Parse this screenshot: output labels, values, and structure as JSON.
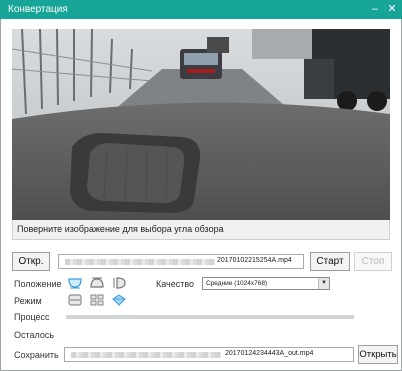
{
  "window": {
    "title": "Конвертация",
    "minimize_glyph": "–",
    "close_glyph": "✕"
  },
  "video": {
    "hint": "Поверните изображение для выбора угла обзора"
  },
  "input": {
    "open_label": "Откр.",
    "filename": "20170102215254A.mp4",
    "start_label": "Старт",
    "stop_label": "Стоп"
  },
  "position": {
    "label": "Положение",
    "icons": [
      "dome-front-icon",
      "dome-back-icon",
      "dome-side-icon"
    ]
  },
  "quality": {
    "label": "Качество",
    "selected": "Средние (1024x768)"
  },
  "mode": {
    "label": "Режим",
    "icons": [
      "panorama-strip-icon",
      "quad-view-icon",
      "diamond-view-icon"
    ]
  },
  "process": {
    "label": "Процесс",
    "progress_fraction": 0.0
  },
  "remaining": {
    "label": "Осталось"
  },
  "save": {
    "label": "Сохранить",
    "filename": "20170124234443A_out.mp4",
    "open_label": "Открыть"
  },
  "colors": {
    "accent": "#16a596",
    "title_text": "#ffffff",
    "icon_active": "#5bb8e8"
  }
}
